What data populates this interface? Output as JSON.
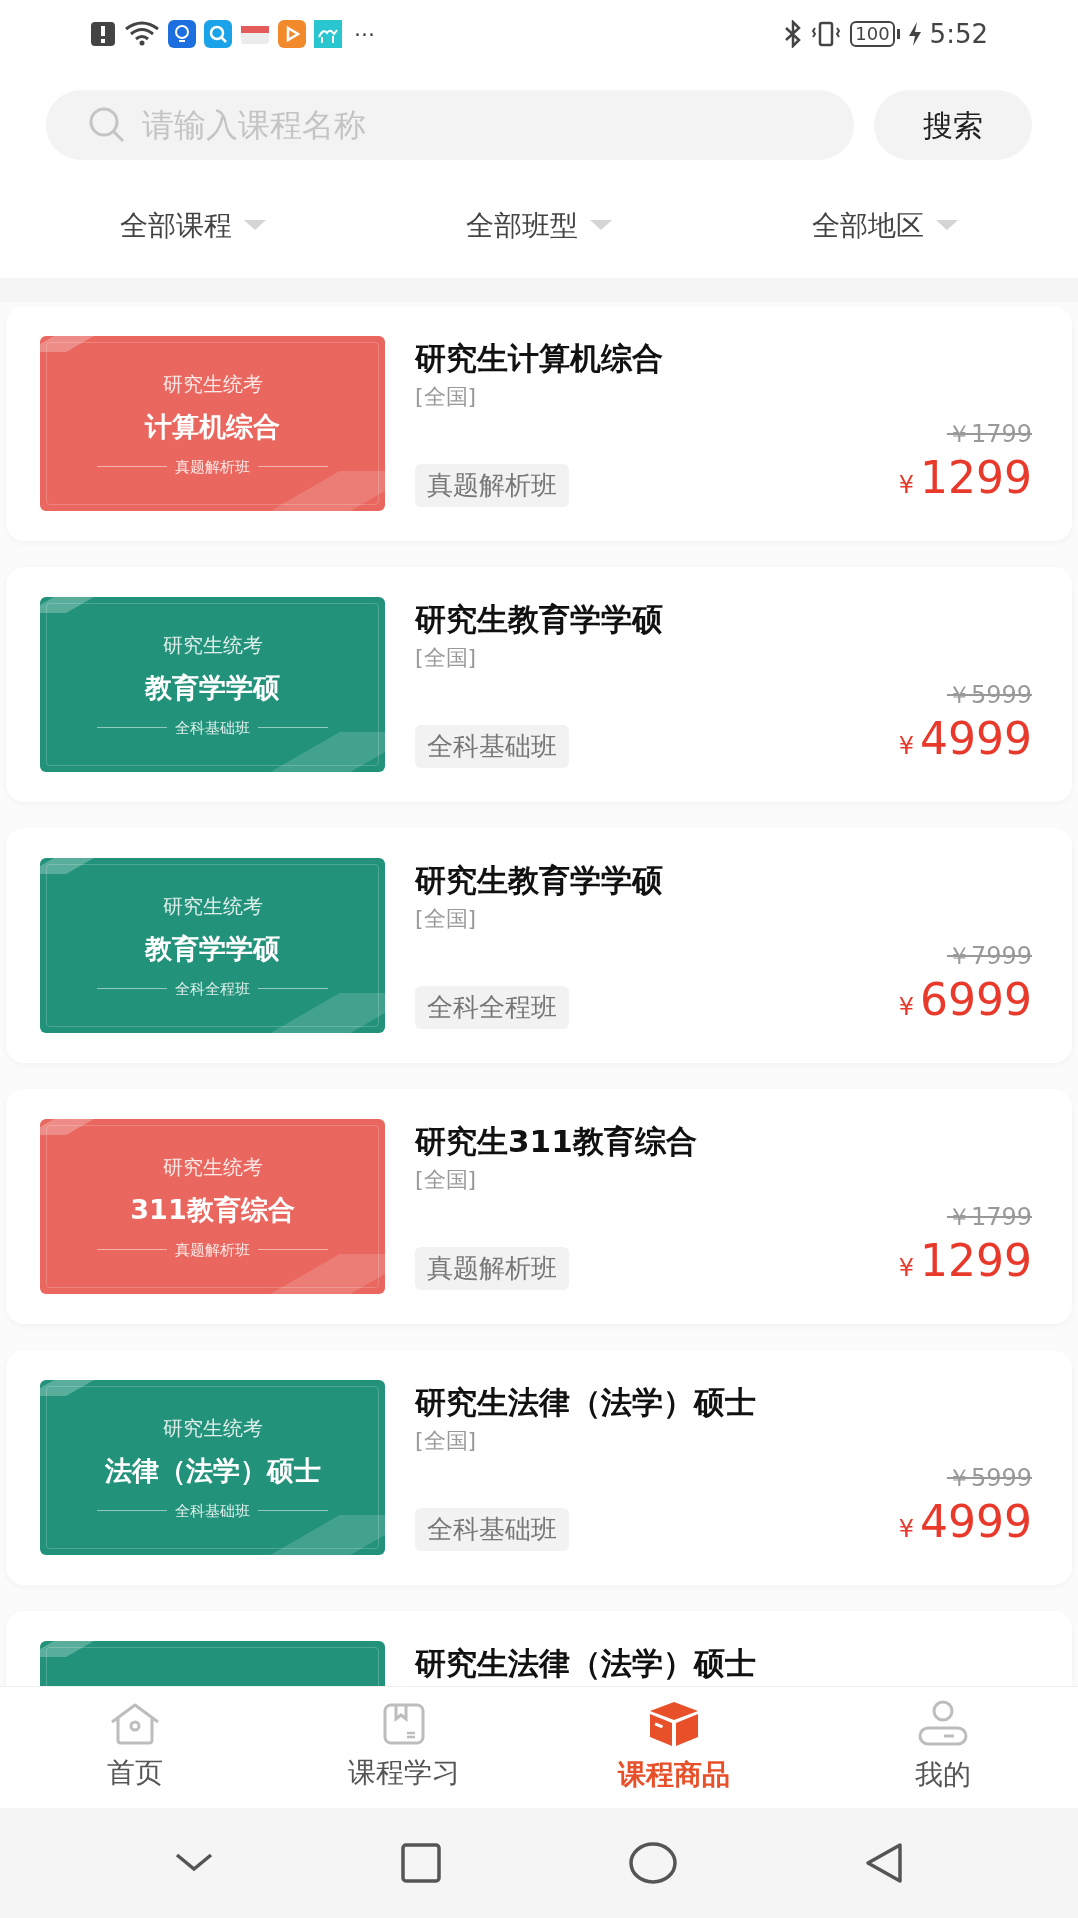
{
  "status_bar": {
    "more": "···",
    "battery": "100",
    "time": "5:52"
  },
  "search": {
    "placeholder": "请输入课程名称",
    "button": "搜索"
  },
  "filters": [
    {
      "label": "全部课程"
    },
    {
      "label": "全部班型"
    },
    {
      "label": "全部地区"
    }
  ],
  "courses": [
    {
      "cover": {
        "color": "#e9675f",
        "top": "研究生统考",
        "main": "计算机综合",
        "bottom": "真题解析班"
      },
      "title": "研究生计算机综合",
      "region": "[全国]",
      "tag": "真题解析班",
      "old_price": "￥1799",
      "currency": "¥",
      "price": "1299"
    },
    {
      "cover": {
        "color": "#22927a",
        "top": "研究生统考",
        "main": "教育学学硕",
        "bottom": "全科基础班"
      },
      "title": "研究生教育学学硕",
      "region": "[全国]",
      "tag": "全科基础班",
      "old_price": "￥5999",
      "currency": "¥",
      "price": "4999"
    },
    {
      "cover": {
        "color": "#22927a",
        "top": "研究生统考",
        "main": "教育学学硕",
        "bottom": "全科全程班"
      },
      "title": "研究生教育学学硕",
      "region": "[全国]",
      "tag": "全科全程班",
      "old_price": "￥7999",
      "currency": "¥",
      "price": "6999"
    },
    {
      "cover": {
        "color": "#e9675f",
        "top": "研究生统考",
        "main": "311教育综合",
        "bottom": "真题解析班"
      },
      "title": "研究生311教育综合",
      "region": "[全国]",
      "tag": "真题解析班",
      "old_price": "￥1799",
      "currency": "¥",
      "price": "1299"
    },
    {
      "cover": {
        "color": "#22927a",
        "top": "研究生统考",
        "main": "法律（法学）硕士",
        "bottom": "全科基础班"
      },
      "title": "研究生法律（法学）硕士",
      "region": "[全国]",
      "tag": "全科基础班",
      "old_price": "￥5999",
      "currency": "¥",
      "price": "4999"
    },
    {
      "cover": {
        "color": "#22927a"
      },
      "title": "研究生法律（法学）硕士"
    }
  ],
  "bottom_nav": [
    {
      "kind": "home",
      "label": "首页",
      "selected": false
    },
    {
      "kind": "study",
      "label": "课程学习",
      "selected": false
    },
    {
      "kind": "shop",
      "label": "课程商品",
      "selected": true
    },
    {
      "kind": "mine",
      "label": "我的",
      "selected": false
    }
  ]
}
